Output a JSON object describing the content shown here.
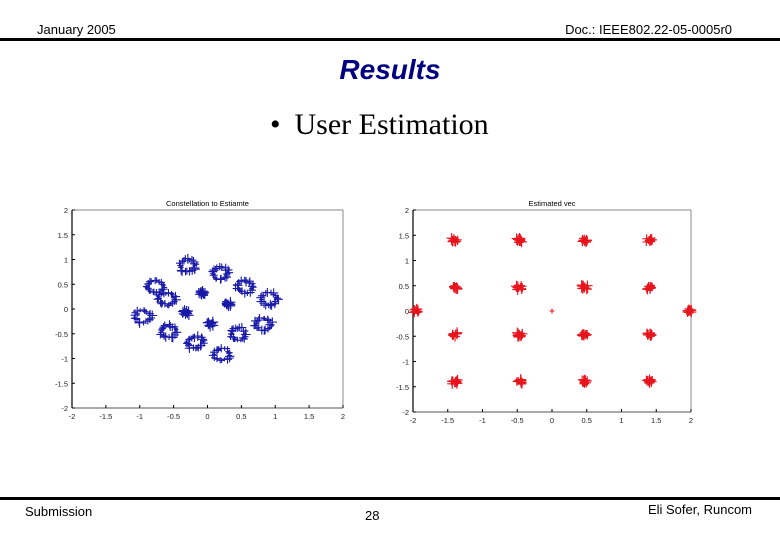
{
  "header": {
    "date": "January 2005",
    "doc_id": "Doc.: IEEE802.22-05-0005r0"
  },
  "slide": {
    "title": "Results",
    "bullet": "User Estimation",
    "bullet_marker": "•"
  },
  "footer": {
    "left": "Submission",
    "page_number": "28",
    "author": "Eli Sofer, Runcom"
  },
  "chart_data": [
    {
      "type": "scatter",
      "title": "Constellation to Estiamte",
      "xlabel": "",
      "ylabel": "",
      "xlim": [
        -2,
        2
      ],
      "ylim": [
        -2,
        2
      ],
      "xticks": [
        "-2",
        "-1.5",
        "-1",
        "-0.5",
        "0",
        "0.5",
        "1",
        "1.5",
        "2"
      ],
      "yticks": [
        "2",
        "1.5",
        "1",
        "0.5",
        "0",
        "-0.5",
        "-1",
        "-1.5",
        "-2"
      ],
      "marker": "+",
      "color": "#1a1aa8",
      "grid": false,
      "clusters": [
        {
          "center": [
            -0.08,
            0.32
          ],
          "kind": "dense"
        },
        {
          "center": [
            0.3,
            0.1
          ],
          "kind": "dense"
        },
        {
          "center": [
            0.04,
            -0.3
          ],
          "kind": "dense"
        },
        {
          "center": [
            -0.32,
            -0.08
          ],
          "kind": "dense"
        },
        {
          "center": [
            -0.3,
            0.88
          ],
          "kind": "ring"
        },
        {
          "center": [
            0.18,
            0.72
          ],
          "kind": "ring"
        },
        {
          "center": [
            0.55,
            0.45
          ],
          "kind": "ring"
        },
        {
          "center": [
            0.92,
            0.2
          ],
          "kind": "ring"
        },
        {
          "center": [
            -0.78,
            0.45
          ],
          "kind": "ring"
        },
        {
          "center": [
            -0.6,
            0.2
          ],
          "kind": "ring"
        },
        {
          "center": [
            -0.95,
            -0.15
          ],
          "kind": "ring"
        },
        {
          "center": [
            -0.58,
            -0.45
          ],
          "kind": "ring"
        },
        {
          "center": [
            -0.18,
            -0.68
          ],
          "kind": "ring"
        },
        {
          "center": [
            0.22,
            -0.92
          ],
          "kind": "ring"
        },
        {
          "center": [
            0.45,
            -0.5
          ],
          "kind": "ring"
        },
        {
          "center": [
            0.82,
            -0.3
          ],
          "kind": "ring"
        }
      ]
    },
    {
      "type": "scatter",
      "title": "Estimated vec",
      "xlabel": "",
      "ylabel": "",
      "xlim": [
        -2,
        2
      ],
      "ylim": [
        -2,
        2
      ],
      "xticks": [
        "-2",
        "-1.5",
        "-1",
        "-0.5",
        "0",
        "0.5",
        "1",
        "1.5",
        "2"
      ],
      "yticks": [
        "2",
        "1.5",
        "1",
        "0.5",
        "0",
        "-0.5",
        "-1",
        "-1.5",
        "-2"
      ],
      "marker": "+",
      "color": "#e8141c",
      "grid": false,
      "clusters": [
        {
          "center": [
            -1.4,
            1.4
          ]
        },
        {
          "center": [
            -0.47,
            1.4
          ]
        },
        {
          "center": [
            0.47,
            1.4
          ]
        },
        {
          "center": [
            1.4,
            1.4
          ]
        },
        {
          "center": [
            -1.4,
            0.47
          ]
        },
        {
          "center": [
            -0.47,
            0.47
          ]
        },
        {
          "center": [
            0.47,
            0.47
          ]
        },
        {
          "center": [
            1.4,
            0.47
          ]
        },
        {
          "center": [
            -1.4,
            -0.47
          ]
        },
        {
          "center": [
            -0.47,
            -0.47
          ]
        },
        {
          "center": [
            0.47,
            -0.47
          ]
        },
        {
          "center": [
            1.4,
            -0.47
          ]
        },
        {
          "center": [
            -1.4,
            -1.4
          ]
        },
        {
          "center": [
            -0.47,
            -1.4
          ]
        },
        {
          "center": [
            0.47,
            -1.4
          ]
        },
        {
          "center": [
            1.4,
            -1.4
          ]
        },
        {
          "center": [
            -1.95,
            0
          ]
        },
        {
          "center": [
            1.97,
            0
          ]
        },
        {
          "center": [
            0,
            0
          ],
          "kind": "single"
        }
      ]
    }
  ]
}
